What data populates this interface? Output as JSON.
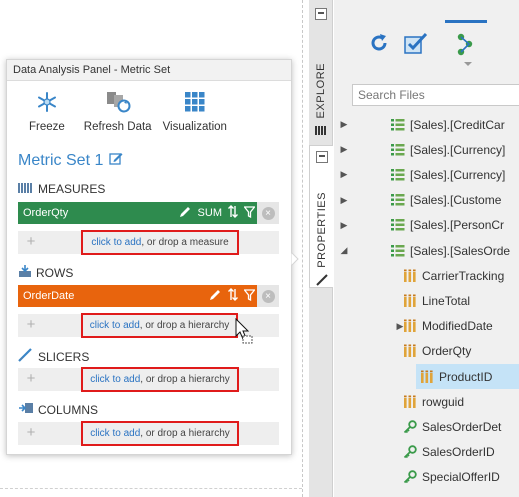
{
  "panel": {
    "title": "Data Analysis Panel - Metric Set",
    "toolbar": [
      {
        "label": "Freeze",
        "icon": "freeze-icon"
      },
      {
        "label": "Refresh Data",
        "icon": "refresh-data-icon"
      },
      {
        "label": "Visualization",
        "icon": "visualization-icon"
      }
    ],
    "metric_set_title": "Metric Set 1",
    "measures": {
      "label": "MEASURES",
      "chip": {
        "name": "OrderQty",
        "aggregate": "SUM"
      },
      "drop": {
        "link": "click to add",
        "text": ", or drop a measure"
      }
    },
    "rows": {
      "label": "ROWS",
      "chip": {
        "name": "OrderDate"
      },
      "drop": {
        "link": "click to add",
        "text": ", or drop a hierarchy"
      }
    },
    "slicers": {
      "label": "SLICERS",
      "drop": {
        "link": "click to add",
        "text": ", or drop a hierarchy"
      }
    },
    "columns": {
      "label": "COLUMNS",
      "drop": {
        "link": "click to add",
        "text": ", or drop a hierarchy"
      }
    }
  },
  "side_tabs": {
    "explore": "EXPLORE",
    "properties": "PROPERTIES"
  },
  "explorer": {
    "search_placeholder": "Search Files",
    "items": [
      {
        "label": "[Sales].[CreditCar",
        "kind": "table",
        "expander": "collapsed"
      },
      {
        "label": "[Sales].[Currency]",
        "kind": "table",
        "expander": "collapsed"
      },
      {
        "label": "[Sales].[Currency]",
        "kind": "table",
        "expander": "collapsed"
      },
      {
        "label": "[Sales].[Custome",
        "kind": "table",
        "expander": "collapsed"
      },
      {
        "label": "[Sales].[PersonCr",
        "kind": "table",
        "expander": "collapsed"
      },
      {
        "label": "[Sales].[SalesOrde",
        "kind": "table",
        "expander": "expanded"
      },
      {
        "label": "CarrierTracking",
        "kind": "column",
        "expander": "none"
      },
      {
        "label": "LineTotal",
        "kind": "column",
        "expander": "none"
      },
      {
        "label": "ModifiedDate",
        "kind": "column",
        "expander": "collapsed"
      },
      {
        "label": "OrderQty",
        "kind": "column",
        "expander": "none"
      },
      {
        "label": "ProductID",
        "kind": "column",
        "expander": "none",
        "selected": true
      },
      {
        "label": "rowguid",
        "kind": "column",
        "expander": "none"
      },
      {
        "label": "SalesOrderDet",
        "kind": "key",
        "expander": "none"
      },
      {
        "label": "SalesOrderID",
        "kind": "key",
        "expander": "none"
      },
      {
        "label": "SpecialOfferID",
        "kind": "key",
        "expander": "none"
      }
    ]
  },
  "colors": {
    "accent": "#2a73c2",
    "measure_chip": "#2e8b4e",
    "row_chip": "#e8640d",
    "highlight_box": "#e01b1b",
    "selection": "#c5e3f7"
  }
}
